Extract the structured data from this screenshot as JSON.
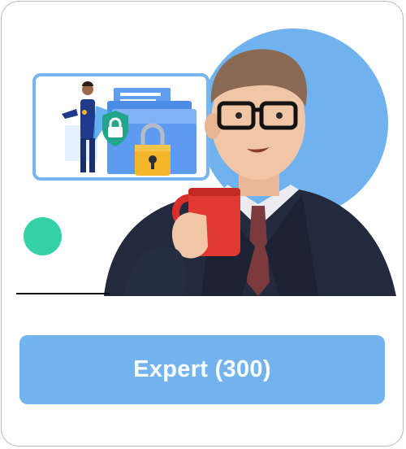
{
  "card": {
    "button_label": "Expert (300)"
  },
  "illustration": {
    "subject": "security-hero-with-shield-and-padlock-icon",
    "icons": [
      "shield-lock-icon",
      "padlock-icon",
      "folder-icon"
    ]
  },
  "colors": {
    "button_background": "#74b4ee",
    "button_text": "#ffffff",
    "circle": "#6fb2ee",
    "accent_dot": "#34d1a6",
    "frame_border": "#78b6f1"
  }
}
